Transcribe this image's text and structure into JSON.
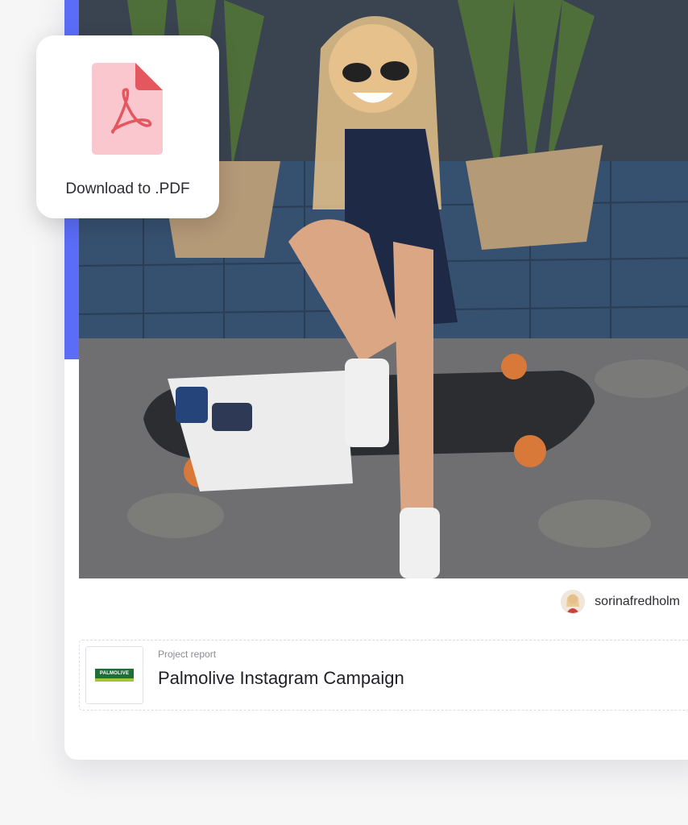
{
  "download": {
    "label": "Download to .PDF",
    "icon": "pdf-file-icon"
  },
  "post": {
    "author_handle": "sorinafredholm"
  },
  "report": {
    "kicker": "Project report",
    "title": "Palmolive Instagram Campaign",
    "brand_logo_text": "PALMOLIVE"
  },
  "colors": {
    "accent": "#5b6cf7",
    "pdf_file_fill": "#f9c7cd",
    "pdf_symbol": "#e4575f",
    "brand_green": "#1f6e37"
  }
}
